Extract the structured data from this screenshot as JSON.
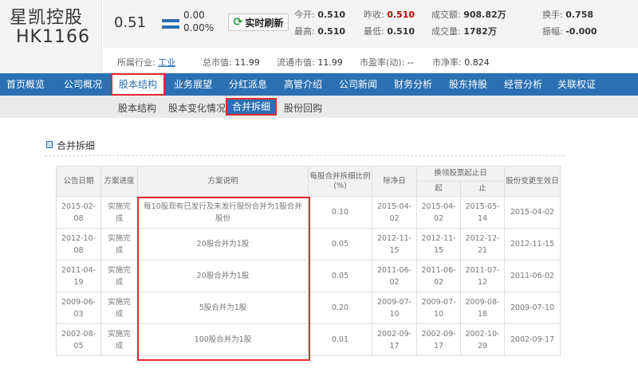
{
  "stock": {
    "name": "星凯控股",
    "code": "HK1166"
  },
  "quote": {
    "price": "0.51",
    "change": "0.00",
    "change_pct": "0.00%",
    "refresh_label": "实时刷新",
    "open_label": "今开:",
    "open": "0.510",
    "prev_close_label": "昨收:",
    "prev_close": "0.510",
    "high_label": "最高:",
    "high": "0.510",
    "low_label": "最低:",
    "low": "0.510",
    "turnover_label": "成交额:",
    "turnover": "908.82万",
    "volume_label": "成交量:",
    "volume": "1782万",
    "turnover_rate_label": "换手:",
    "turnover_rate": "0.758",
    "amplitude_label": "振幅:",
    "amplitude": "-0.000",
    "price_color": "#333333",
    "prev_close_color": "#c00000"
  },
  "info": {
    "industry_label": "所属行业:",
    "industry": "工业",
    "market_cap_label": "总市值:",
    "market_cap": "11.99",
    "float_cap_label": "流通市值:",
    "float_cap": "11.99",
    "pe_label": "市盈率(动):",
    "pe": "--",
    "pb_label": "市净率:",
    "pb": "0.824"
  },
  "nav": {
    "items": [
      "首页概览",
      "公司概况",
      "股本结构",
      "业务展望",
      "分红派息",
      "高管介绍",
      "公司新闻",
      "财务分析",
      "股东持股",
      "经营分析",
      "关联权证"
    ],
    "active_index": 2,
    "color": "#2a70b2"
  },
  "subnav": {
    "items": [
      "股本结构",
      "股本变化情况",
      "合并拆细",
      "股份回购"
    ],
    "active_index": 2
  },
  "section": {
    "title": "合并拆细"
  },
  "table": {
    "headers": {
      "date": "公告日期",
      "progress": "方案进度",
      "desc": "方案说明",
      "ratio": "每股合并拆细比例",
      "ratio_unit": "(%)",
      "exdate": "除净日",
      "period": "换领股票起止日",
      "period_start": "起",
      "period_end": "止",
      "effective": "股份变更生效日"
    },
    "rows": [
      {
        "date": [
          "2015-02-",
          "08"
        ],
        "progress": [
          "实施完",
          "成"
        ],
        "desc": [
          "每10股现有已发行及未发行股份合并为1股合并",
          "股份"
        ],
        "ratio": "0.10",
        "exdate": [
          "2015-04-",
          "02"
        ],
        "start": [
          "2015-04-",
          "02"
        ],
        "end": [
          "2015-05-",
          "14"
        ],
        "effective": "2015-04-02"
      },
      {
        "date": [
          "2012-10-",
          "08"
        ],
        "progress": [
          "实施完",
          "成"
        ],
        "desc": [
          "20股合并为1股",
          ""
        ],
        "ratio": "0.05",
        "exdate": [
          "2012-11-",
          "15"
        ],
        "start": [
          "2012-11-",
          "15"
        ],
        "end": [
          "2012-12-",
          "21"
        ],
        "effective": "2012-11-15"
      },
      {
        "date": [
          "2011-04-",
          "19"
        ],
        "progress": [
          "实施完",
          "成"
        ],
        "desc": [
          "20股合并为1股",
          ""
        ],
        "ratio": "0.05",
        "exdate": [
          "2011-06-",
          "02"
        ],
        "start": [
          "2011-06-",
          "02"
        ],
        "end": [
          "2011-07-",
          "12"
        ],
        "effective": "2011-06-02"
      },
      {
        "date": [
          "2009-06-",
          "03"
        ],
        "progress": [
          "实施完",
          "成"
        ],
        "desc": [
          "5股合并为1股",
          ""
        ],
        "ratio": "0.20",
        "exdate": [
          "2009-07-",
          "10"
        ],
        "start": [
          "2009-07-",
          "10"
        ],
        "end": [
          "2009-08-",
          "18"
        ],
        "effective": "2009-07-10"
      },
      {
        "date": [
          "2002-08-",
          "05"
        ],
        "progress": [
          "实施完",
          "成"
        ],
        "desc": [
          "100股合并为1股",
          ""
        ],
        "ratio": "0.01",
        "exdate": [
          "2002-09-",
          "17"
        ],
        "start": [
          "2002-09-",
          "17"
        ],
        "end": [
          "2002-10-",
          "29"
        ],
        "effective": "2002-09-17"
      }
    ]
  }
}
